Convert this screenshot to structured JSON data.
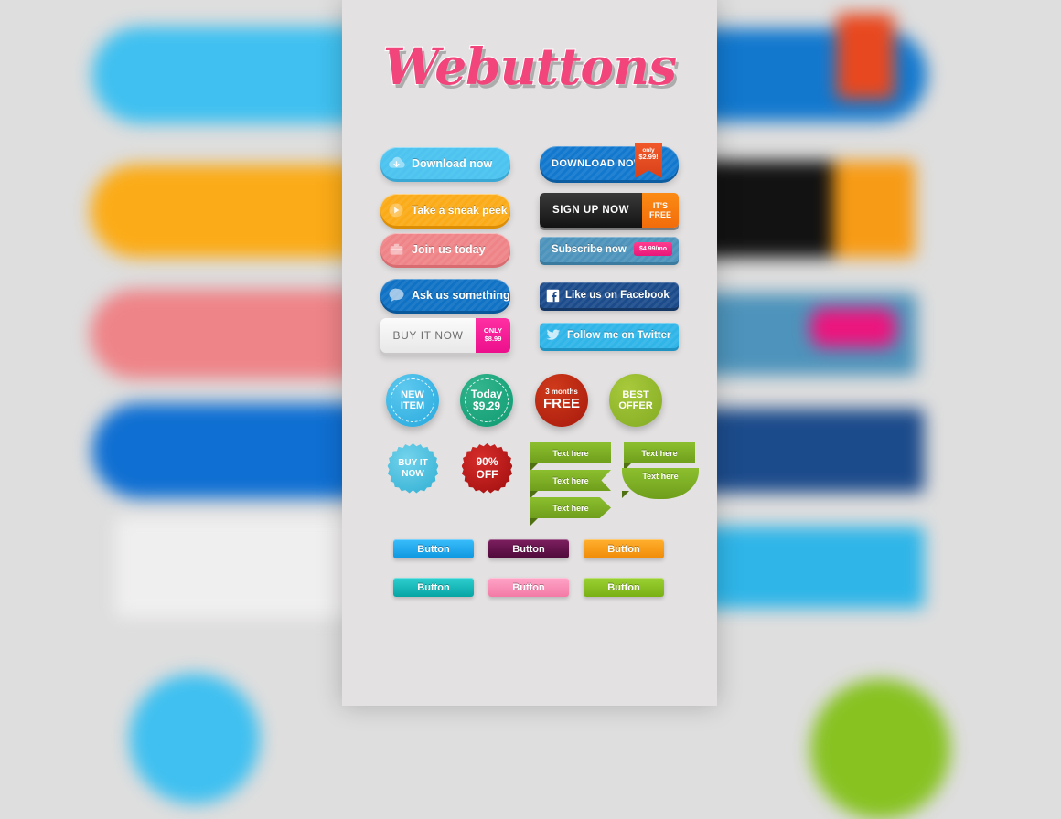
{
  "page": {
    "title": "Webuttons",
    "background_color": "#dedede",
    "panel_color": "#e3e1e1",
    "title_color": "#f2457c"
  },
  "pill_buttons": [
    {
      "id": "download-now",
      "label": "Download now",
      "icon": "cloud-download-icon",
      "color": "#4ec3f0"
    },
    {
      "id": "sneak-peek",
      "label": "Take a sneak peek",
      "icon": "play-icon",
      "color": "#fbab17"
    },
    {
      "id": "join-us",
      "label": "Join us today",
      "icon": "briefcase-icon",
      "color": "#ee8488"
    },
    {
      "id": "ask-us",
      "label": "Ask us something",
      "icon": "chat-bubble-icon",
      "color": "#0f72c4"
    }
  ],
  "buy_it_now": {
    "label": "BUY IT NOW",
    "tag_line1": "ONLY",
    "tag_line2": "$8.99",
    "tag_color": "#ec0f8c"
  },
  "right_buttons": {
    "download": {
      "label": "DOWNLOAD NOW",
      "ribbon_line1": "only",
      "ribbon_line2": "$2.99!",
      "color": "#1278ce",
      "ribbon_color": "#e8481f"
    },
    "signup": {
      "label": "SIGN UP NOW",
      "tag_line1": "IT'S",
      "tag_line2": "FREE",
      "color": "#1a1a1a",
      "tag_color": "#f77d0f"
    },
    "subscribe": {
      "label": "Subscribe now",
      "tag": "$4.99/mo",
      "color": "#4d93bb",
      "tag_color": "#e8177a"
    },
    "facebook": {
      "label": "Like us on Facebook",
      "icon": "facebook-icon",
      "color": "#1c4b8b"
    },
    "twitter": {
      "label": "Follow me on Twitter",
      "icon": "twitter-bird-icon",
      "color": "#2fb5e8"
    }
  },
  "circle_badges": [
    {
      "id": "new-item",
      "line1": "NEW",
      "line2": "ITEM",
      "color": "#25a8dd",
      "dashed": true
    },
    {
      "id": "today-price",
      "line1": "Today",
      "line2": "$9.29",
      "color": "#0e9a72",
      "dashed": true
    },
    {
      "id": "months-free",
      "line1": "3 months",
      "line2": "FREE",
      "color": "#a7190c",
      "dashed": false
    },
    {
      "id": "best-offer",
      "line1": "BEST",
      "line2": "OFFER",
      "color": "#83ab23",
      "dashed": false
    }
  ],
  "star_badges": [
    {
      "id": "buy-it-now-star",
      "line1": "BUY IT",
      "line2": "NOW",
      "color": "#2eaed2"
    },
    {
      "id": "ninety-off-star",
      "line1": "90%",
      "line2": "OFF",
      "color": "#9e0d0d"
    }
  ],
  "green_ribbons": [
    {
      "id": "ribbon-plain-left",
      "label": "Text here"
    },
    {
      "id": "ribbon-plain-right",
      "label": "Text here"
    },
    {
      "id": "ribbon-notched",
      "label": "Text here"
    },
    {
      "id": "ribbon-arrow",
      "label": "Text here"
    },
    {
      "id": "ribbon-curved",
      "label": "Text here"
    }
  ],
  "small_buttons": [
    {
      "id": "button-blue",
      "label": "Button",
      "color": "#1aa8f0"
    },
    {
      "id": "button-purple",
      "label": "Button",
      "color": "#6d1150"
    },
    {
      "id": "button-orange",
      "label": "Button",
      "color": "#f79b16"
    },
    {
      "id": "button-teal",
      "label": "Button",
      "color": "#0fb4b4"
    },
    {
      "id": "button-pink",
      "label": "Button",
      "color": "#fb8ab4"
    },
    {
      "id": "button-green",
      "label": "Button",
      "color": "#87c221"
    }
  ]
}
